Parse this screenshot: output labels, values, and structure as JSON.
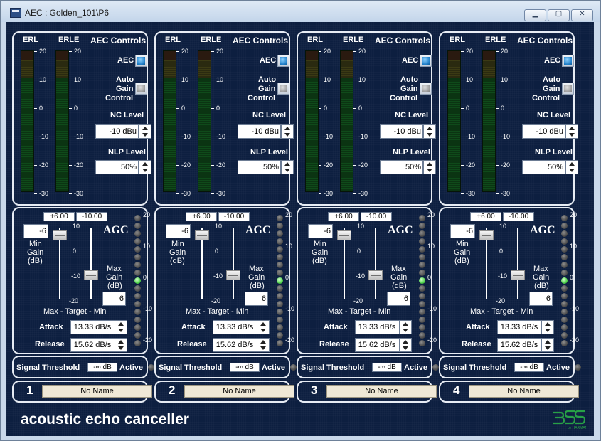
{
  "window": {
    "title": "AEC : Golden_101\\P6",
    "minimize_icon": "minimize-icon",
    "maximize_icon": "maximize-icon",
    "close_icon": "close-icon"
  },
  "labels": {
    "erl": "ERL",
    "erle": "ERLE",
    "aec_controls": "AEC Controls",
    "aec": "AEC",
    "auto_gain_line1": "Auto",
    "auto_gain_line2": "Gain",
    "auto_gain_line3": "Control",
    "nc_level": "NC Level",
    "nlp_level": "NLP Level",
    "agc": "AGC",
    "min_gain_line1": "Min",
    "min_gain_line2": "Gain",
    "min_gain_line3": "(dB)",
    "max_gain_line1": "Max",
    "max_gain_line2": "Gain",
    "max_gain_line3": "(dB)",
    "max_target_min": "Max - Target - Min",
    "attack": "Attack",
    "release": "Release",
    "signal_threshold": "Signal Threshold",
    "active": "Active"
  },
  "meter_scale": [
    "20",
    "10",
    "0",
    "-10",
    "-20",
    "-30"
  ],
  "slider_scale": [
    "10",
    "0",
    "-10",
    "-20"
  ],
  "led_scale": [
    "20",
    "10",
    "0",
    "-10",
    "-20"
  ],
  "channels": [
    {
      "number": "1",
      "name": "No Name",
      "aec_on": true,
      "agc_on": false,
      "nc_level": "-10 dBu",
      "nlp_level": "50%",
      "max_value": "+6.00",
      "min_value": "-10.00",
      "min_gain": "-6",
      "max_gain": "6",
      "attack": "13.33 dB/s",
      "release": "15.62 dB/s",
      "threshold": "-∞ dB"
    },
    {
      "number": "2",
      "name": "No Name",
      "aec_on": true,
      "agc_on": false,
      "nc_level": "-10 dBu",
      "nlp_level": "50%",
      "max_value": "+6.00",
      "min_value": "-10.00",
      "min_gain": "-6",
      "max_gain": "6",
      "attack": "13.33 dB/s",
      "release": "15.62 dB/s",
      "threshold": "-∞ dB"
    },
    {
      "number": "3",
      "name": "No Name",
      "aec_on": true,
      "agc_on": false,
      "nc_level": "-10 dBu",
      "nlp_level": "50%",
      "max_value": "+6.00",
      "min_value": "-10.00",
      "min_gain": "-6",
      "max_gain": "6",
      "attack": "13.33 dB/s",
      "release": "15.62 dB/s",
      "threshold": "-∞ dB"
    },
    {
      "number": "4",
      "name": "No Name",
      "aec_on": true,
      "agc_on": false,
      "nc_level": "-10 dBu",
      "nlp_level": "50%",
      "max_value": "+6.00",
      "min_value": "-10.00",
      "min_gain": "-6",
      "max_gain": "6",
      "attack": "13.33 dB/s",
      "release": "15.62 dB/s",
      "threshold": "-∞ dB"
    }
  ],
  "footer": {
    "title": "acoustic echo canceller",
    "logo_icon": "bss-harman-logo-icon"
  },
  "colors": {
    "panel_bg": "#0d1f40",
    "border": "#e7ecf4",
    "led_active": "#4fd34a",
    "aec_button_on": "#1f7ec8"
  }
}
